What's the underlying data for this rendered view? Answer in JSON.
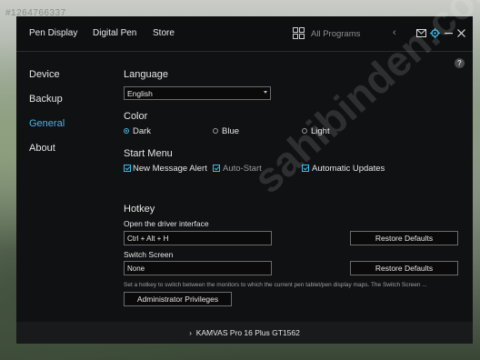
{
  "watermark_id": "#1264766337",
  "header": {
    "tabs": [
      "Pen Display",
      "Digital Pen",
      "Store"
    ],
    "programs_label": "All Programs"
  },
  "help_label": "?",
  "sidebar": {
    "items": [
      "Device",
      "Backup",
      "General",
      "About"
    ],
    "active": "General"
  },
  "language": {
    "title": "Language",
    "selected": "English"
  },
  "color": {
    "title": "Color",
    "options": [
      "Dark",
      "Blue",
      "Light"
    ],
    "selected": "Dark"
  },
  "start_menu": {
    "title": "Start Menu",
    "options": [
      "New Message Alert",
      "Auto-Start",
      "Automatic Updates"
    ]
  },
  "hotkey": {
    "title": "Hotkey",
    "driver_label": "Open the driver interface",
    "driver_value": "Ctrl + Alt + H",
    "switch_label": "Switch Screen",
    "switch_value": "None",
    "restore_label": "Restore Defaults",
    "hint": "Set a hotkey to switch between the monitors to which the current pen tablet/pen display maps. The Switch Screen ...",
    "admin_label": "Administrator Privileges"
  },
  "footer": {
    "device_name": "KAMVAS Pro 16 Plus GT1562"
  },
  "site_watermark": "sahibinden.com",
  "colors": {
    "accent": "#3fb9e6",
    "window_bg": "#101112"
  }
}
